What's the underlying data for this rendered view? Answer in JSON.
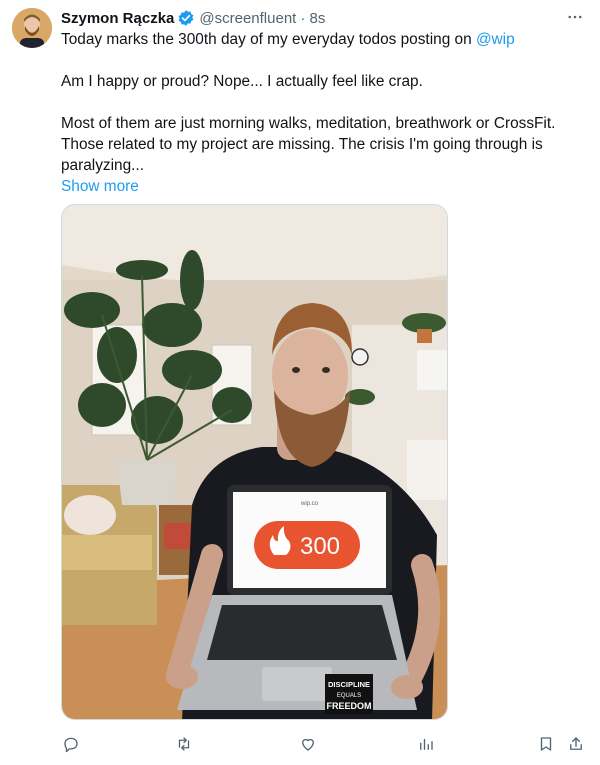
{
  "tweet": {
    "author_name": "Szymon Rączka",
    "handle": "@screenfluent",
    "time": "· 8s",
    "text": {
      "line1_prefix": "Today marks the 300th day of my everyday todos posting on ",
      "line1_mention": "@wip",
      "para2": "Am I happy or proud? Nope... I actually feel like crap.",
      "para3_line1": "Most of them are just morning walks, meditation, breathwork or CrossFit.",
      "para3_line2": "Those related to my project are missing. The crisis I'm going through is",
      "para3_line3": "paralyzing..."
    },
    "show_more": "Show more"
  },
  "media": {
    "laptop_url": "wip.co",
    "badge_count": "300",
    "sticker": {
      "line1": "DISCIPLINE",
      "line2": "EQUALS",
      "line3": "FREEDOM"
    }
  },
  "actions": [
    "reply-icon",
    "retweet-icon",
    "like-icon",
    "views-icon",
    "bookmark-icon",
    "share-icon"
  ],
  "colors": {
    "link": "#1d9bf0",
    "badge": "#e8542f",
    "verified": "#1d9bf0",
    "icon": "#536471"
  }
}
